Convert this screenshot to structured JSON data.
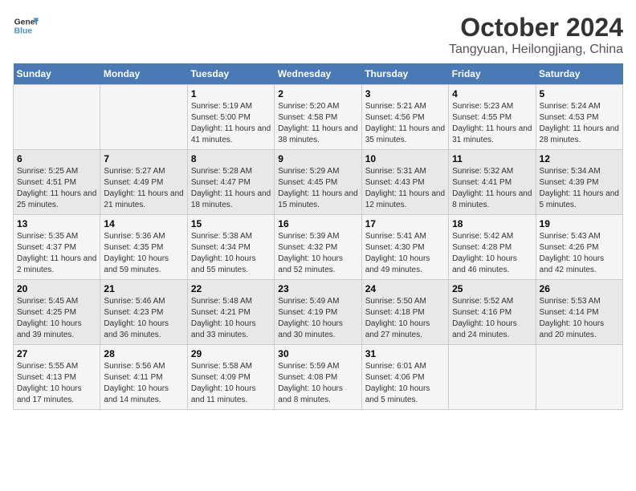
{
  "header": {
    "logo_line1": "General",
    "logo_line2": "Blue",
    "title": "October 2024",
    "subtitle": "Tangyuan, Heilongjiang, China"
  },
  "days_of_week": [
    "Sunday",
    "Monday",
    "Tuesday",
    "Wednesday",
    "Thursday",
    "Friday",
    "Saturday"
  ],
  "weeks": [
    [
      {
        "day": "",
        "info": ""
      },
      {
        "day": "",
        "info": ""
      },
      {
        "day": "1",
        "info": "Sunrise: 5:19 AM\nSunset: 5:00 PM\nDaylight: 11 hours and 41 minutes."
      },
      {
        "day": "2",
        "info": "Sunrise: 5:20 AM\nSunset: 4:58 PM\nDaylight: 11 hours and 38 minutes."
      },
      {
        "day": "3",
        "info": "Sunrise: 5:21 AM\nSunset: 4:56 PM\nDaylight: 11 hours and 35 minutes."
      },
      {
        "day": "4",
        "info": "Sunrise: 5:23 AM\nSunset: 4:55 PM\nDaylight: 11 hours and 31 minutes."
      },
      {
        "day": "5",
        "info": "Sunrise: 5:24 AM\nSunset: 4:53 PM\nDaylight: 11 hours and 28 minutes."
      }
    ],
    [
      {
        "day": "6",
        "info": "Sunrise: 5:25 AM\nSunset: 4:51 PM\nDaylight: 11 hours and 25 minutes."
      },
      {
        "day": "7",
        "info": "Sunrise: 5:27 AM\nSunset: 4:49 PM\nDaylight: 11 hours and 21 minutes."
      },
      {
        "day": "8",
        "info": "Sunrise: 5:28 AM\nSunset: 4:47 PM\nDaylight: 11 hours and 18 minutes."
      },
      {
        "day": "9",
        "info": "Sunrise: 5:29 AM\nSunset: 4:45 PM\nDaylight: 11 hours and 15 minutes."
      },
      {
        "day": "10",
        "info": "Sunrise: 5:31 AM\nSunset: 4:43 PM\nDaylight: 11 hours and 12 minutes."
      },
      {
        "day": "11",
        "info": "Sunrise: 5:32 AM\nSunset: 4:41 PM\nDaylight: 11 hours and 8 minutes."
      },
      {
        "day": "12",
        "info": "Sunrise: 5:34 AM\nSunset: 4:39 PM\nDaylight: 11 hours and 5 minutes."
      }
    ],
    [
      {
        "day": "13",
        "info": "Sunrise: 5:35 AM\nSunset: 4:37 PM\nDaylight: 11 hours and 2 minutes."
      },
      {
        "day": "14",
        "info": "Sunrise: 5:36 AM\nSunset: 4:35 PM\nDaylight: 10 hours and 59 minutes."
      },
      {
        "day": "15",
        "info": "Sunrise: 5:38 AM\nSunset: 4:34 PM\nDaylight: 10 hours and 55 minutes."
      },
      {
        "day": "16",
        "info": "Sunrise: 5:39 AM\nSunset: 4:32 PM\nDaylight: 10 hours and 52 minutes."
      },
      {
        "day": "17",
        "info": "Sunrise: 5:41 AM\nSunset: 4:30 PM\nDaylight: 10 hours and 49 minutes."
      },
      {
        "day": "18",
        "info": "Sunrise: 5:42 AM\nSunset: 4:28 PM\nDaylight: 10 hours and 46 minutes."
      },
      {
        "day": "19",
        "info": "Sunrise: 5:43 AM\nSunset: 4:26 PM\nDaylight: 10 hours and 42 minutes."
      }
    ],
    [
      {
        "day": "20",
        "info": "Sunrise: 5:45 AM\nSunset: 4:25 PM\nDaylight: 10 hours and 39 minutes."
      },
      {
        "day": "21",
        "info": "Sunrise: 5:46 AM\nSunset: 4:23 PM\nDaylight: 10 hours and 36 minutes."
      },
      {
        "day": "22",
        "info": "Sunrise: 5:48 AM\nSunset: 4:21 PM\nDaylight: 10 hours and 33 minutes."
      },
      {
        "day": "23",
        "info": "Sunrise: 5:49 AM\nSunset: 4:19 PM\nDaylight: 10 hours and 30 minutes."
      },
      {
        "day": "24",
        "info": "Sunrise: 5:50 AM\nSunset: 4:18 PM\nDaylight: 10 hours and 27 minutes."
      },
      {
        "day": "25",
        "info": "Sunrise: 5:52 AM\nSunset: 4:16 PM\nDaylight: 10 hours and 24 minutes."
      },
      {
        "day": "26",
        "info": "Sunrise: 5:53 AM\nSunset: 4:14 PM\nDaylight: 10 hours and 20 minutes."
      }
    ],
    [
      {
        "day": "27",
        "info": "Sunrise: 5:55 AM\nSunset: 4:13 PM\nDaylight: 10 hours and 17 minutes."
      },
      {
        "day": "28",
        "info": "Sunrise: 5:56 AM\nSunset: 4:11 PM\nDaylight: 10 hours and 14 minutes."
      },
      {
        "day": "29",
        "info": "Sunrise: 5:58 AM\nSunset: 4:09 PM\nDaylight: 10 hours and 11 minutes."
      },
      {
        "day": "30",
        "info": "Sunrise: 5:59 AM\nSunset: 4:08 PM\nDaylight: 10 hours and 8 minutes."
      },
      {
        "day": "31",
        "info": "Sunrise: 6:01 AM\nSunset: 4:06 PM\nDaylight: 10 hours and 5 minutes."
      },
      {
        "day": "",
        "info": ""
      },
      {
        "day": "",
        "info": ""
      }
    ]
  ]
}
